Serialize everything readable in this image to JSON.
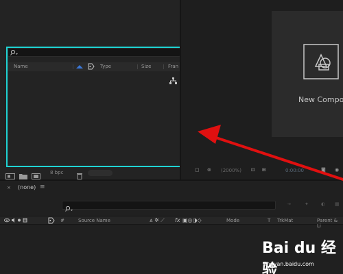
{
  "project": {
    "columns": {
      "name": "Name",
      "type": "Type",
      "size": "Size",
      "frame": "Fran"
    },
    "bit_depth": "8 bpc"
  },
  "composition": {
    "new_comp_label": "New Compo",
    "zoom": "(2000%)",
    "timecode": "0:00:00"
  },
  "timeline": {
    "comp_name": "(none)",
    "columns": {
      "hash": "#",
      "source_name": "Source Name",
      "fx": "fx",
      "mode": "Mode",
      "t": "T",
      "trkmat": "TrkMat",
      "parent": "Parent & Li"
    }
  },
  "watermark": {
    "brand": "Bai du 经验",
    "url": "jingyan.baidu.com"
  },
  "colors": {
    "highlight": "#1fd3d3",
    "arrow": "#e01010",
    "label_tag": "#4a7fd0"
  },
  "icons": [
    "search-icon",
    "label-tag-icon",
    "flowchart-icon",
    "trash-icon",
    "folder-icon",
    "comp-icon",
    "new-comp-icon"
  ]
}
